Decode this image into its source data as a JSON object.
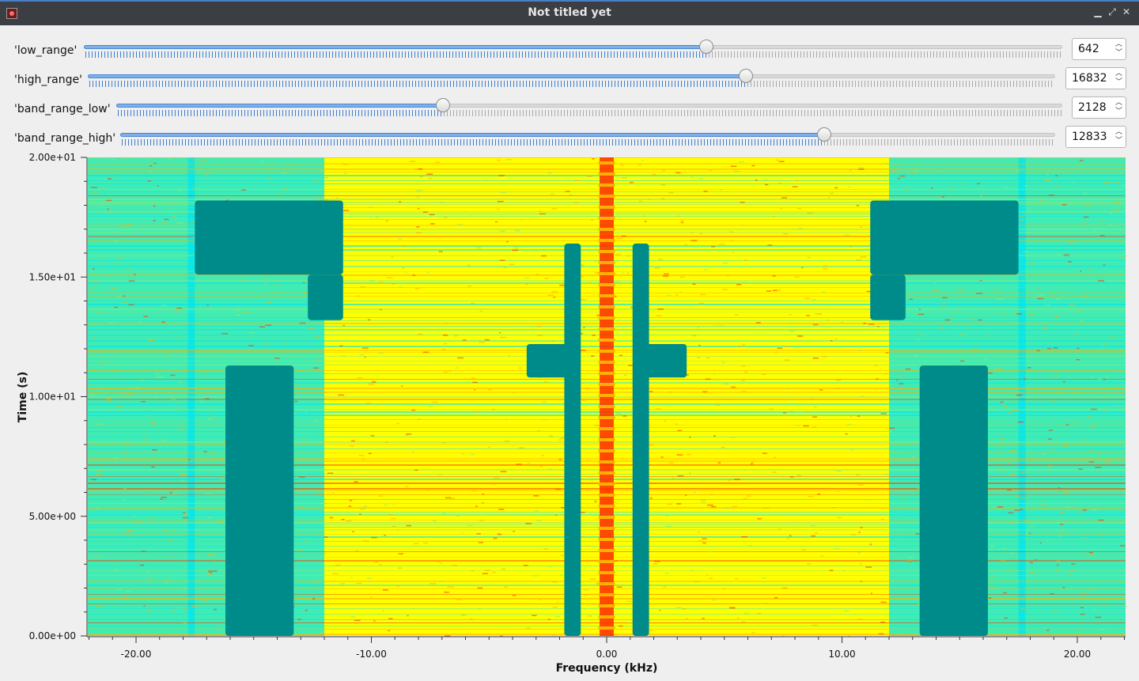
{
  "window": {
    "title": "Not titled yet",
    "icon": "app-icon"
  },
  "controls": [
    {
      "label": "'low_range'",
      "value": "642",
      "position": 0.639
    },
    {
      "label": "'high_range'",
      "value": "16832",
      "position": 0.677
    },
    {
      "label": "'band_range_low'",
      "value": "2128",
      "position": 0.346
    },
    {
      "label": "'band_range_high'",
      "value": "12833",
      "position": 0.754
    }
  ],
  "chart_data": {
    "type": "heatmap",
    "title": "",
    "xlabel": "Frequency (kHz)",
    "ylabel": "Time (s)",
    "xlim": [
      -22.05,
      22.05
    ],
    "ylim": [
      0,
      20
    ],
    "x_ticks": [
      {
        "value": -20,
        "label": "-20.00"
      },
      {
        "value": -10,
        "label": "-10.00"
      },
      {
        "value": 0,
        "label": "0.00"
      },
      {
        "value": 10,
        "label": "10.00"
      },
      {
        "value": 20,
        "label": "20.00"
      }
    ],
    "y_ticks": [
      {
        "value": 0,
        "label": "0.00e+00"
      },
      {
        "value": 5,
        "label": "5.00e+00"
      },
      {
        "value": 10,
        "label": "1.00e+01"
      },
      {
        "value": 15,
        "label": "1.50e+01"
      },
      {
        "value": 20,
        "label": "2.00e+01"
      }
    ],
    "colormap": [
      "#00e5f0",
      "#8fe87a",
      "#ffff00",
      "#ffb000",
      "#ff3a00"
    ],
    "low_band_color": "#008b8b",
    "dark_regions": [
      {
        "x": [
          -16.2,
          -13.3
        ],
        "y": [
          0,
          11.3
        ]
      },
      {
        "x": [
          13.3,
          16.2
        ],
        "y": [
          0,
          11.3
        ]
      },
      {
        "x": [
          -17.5,
          -11.2
        ],
        "y": [
          15.1,
          18.2
        ]
      },
      {
        "x": [
          11.2,
          17.5
        ],
        "y": [
          15.1,
          18.2
        ]
      },
      {
        "x": [
          -12.7,
          -11.2
        ],
        "y": [
          13.2,
          15.1
        ]
      },
      {
        "x": [
          11.2,
          12.7
        ],
        "y": [
          13.2,
          15.1
        ]
      },
      {
        "x": [
          -3.4,
          -1.4
        ],
        "y": [
          10.8,
          12.2
        ]
      },
      {
        "x": [
          1.4,
          3.4
        ],
        "y": [
          10.8,
          12.2
        ]
      },
      {
        "x": [
          -1.8,
          -1.1
        ],
        "y": [
          0,
          16.4
        ]
      },
      {
        "x": [
          1.1,
          1.8
        ],
        "y": [
          0,
          16.4
        ]
      }
    ],
    "cyan_regions": [
      {
        "x": [
          -22.05,
          -17.5
        ],
        "y": [
          0,
          20
        ]
      },
      {
        "x": [
          17.5,
          22.05
        ],
        "y": [
          0,
          20
        ]
      },
      {
        "x": [
          -17.8,
          -12.0
        ],
        "y": [
          0,
          20
        ]
      },
      {
        "x": [
          12.0,
          17.8
        ],
        "y": [
          0,
          20
        ]
      }
    ],
    "center_line": {
      "x": 0,
      "width": 0.6,
      "color": "#ff2a00"
    },
    "horizontal_striping": true,
    "grid": false
  }
}
